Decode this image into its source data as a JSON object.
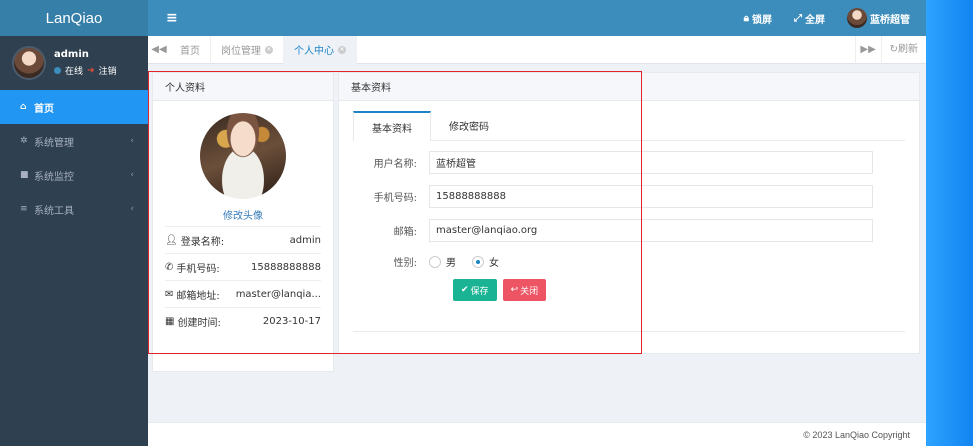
{
  "brand": "LanQiao",
  "user": {
    "name": "admin",
    "status": "在线",
    "logout": "注销"
  },
  "nav": [
    {
      "label": "首页",
      "icon": "home-icon"
    },
    {
      "label": "系统管理",
      "icon": "gear-icon"
    },
    {
      "label": "系统监控",
      "icon": "video-icon"
    },
    {
      "label": "系统工具",
      "icon": "bars-icon"
    }
  ],
  "topbar": {
    "lock": "锁屏",
    "fullscreen": "全屏",
    "username": "蓝桥超管"
  },
  "tabs": [
    {
      "label": "首页"
    },
    {
      "label": "岗位管理"
    },
    {
      "label": "个人中心"
    }
  ],
  "tabs_refresh": "刷新",
  "profile": {
    "title": "个人资料",
    "change_avatar": "修改头像",
    "rows": [
      {
        "label": "登录名称:",
        "value": "admin"
      },
      {
        "label": "手机号码:",
        "value": "15888888888"
      },
      {
        "label": "邮箱地址:",
        "value": "master@lanqia..."
      },
      {
        "label": "创建时间:",
        "value": "2023-10-17"
      }
    ]
  },
  "basic": {
    "title": "基本资料",
    "tab_basic": "基本资料",
    "tab_password": "修改密码",
    "fields": {
      "username_label": "用户名称:",
      "username_value": "蓝桥超管",
      "phone_label": "手机号码:",
      "phone_value": "15888888888",
      "email_label": "邮箱:",
      "email_value": "master@lanqiao.org",
      "gender_label": "性别:",
      "male": "男",
      "female": "女",
      "gender_selected": "女"
    },
    "save": "保存",
    "close": "关闭"
  },
  "footer": "© 2023 LanQiao Copyright"
}
